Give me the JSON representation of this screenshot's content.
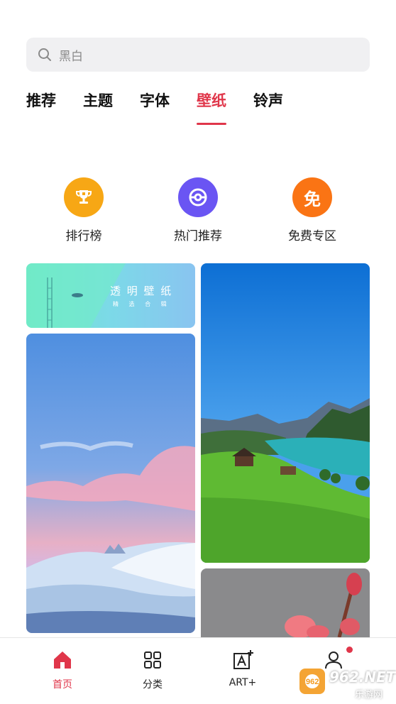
{
  "search": {
    "placeholder": "黑白",
    "icon": "search-icon"
  },
  "tabs": [
    {
      "label": "推荐",
      "active": false
    },
    {
      "label": "主题",
      "active": false
    },
    {
      "label": "字体",
      "active": false
    },
    {
      "label": "壁纸",
      "active": true
    },
    {
      "label": "铃声",
      "active": false
    }
  ],
  "shortcuts": [
    {
      "label": "排行榜",
      "icon": "trophy-icon",
      "color": "#f7a715"
    },
    {
      "label": "热门推荐",
      "icon": "hot-ball-icon",
      "color": "#6a55f3"
    },
    {
      "label": "免费专区",
      "icon": "free-icon",
      "color": "#fa7414",
      "glyph": "免"
    }
  ],
  "wallpapers": [
    {
      "title": "透 明 壁 纸",
      "subtitle": "精 选 合 辑"
    }
  ],
  "bottom_nav": [
    {
      "label": "首页",
      "icon": "home-icon",
      "active": true
    },
    {
      "label": "分类",
      "icon": "grid-icon",
      "active": false
    },
    {
      "label": "ART+",
      "icon": "art-plus-icon",
      "active": false
    },
    {
      "label": "",
      "icon": "profile-icon",
      "active": false,
      "badge": true
    }
  ],
  "watermark": {
    "text": "962.NET",
    "subtext": "乐游网"
  },
  "colors": {
    "accent": "#e0364a"
  }
}
